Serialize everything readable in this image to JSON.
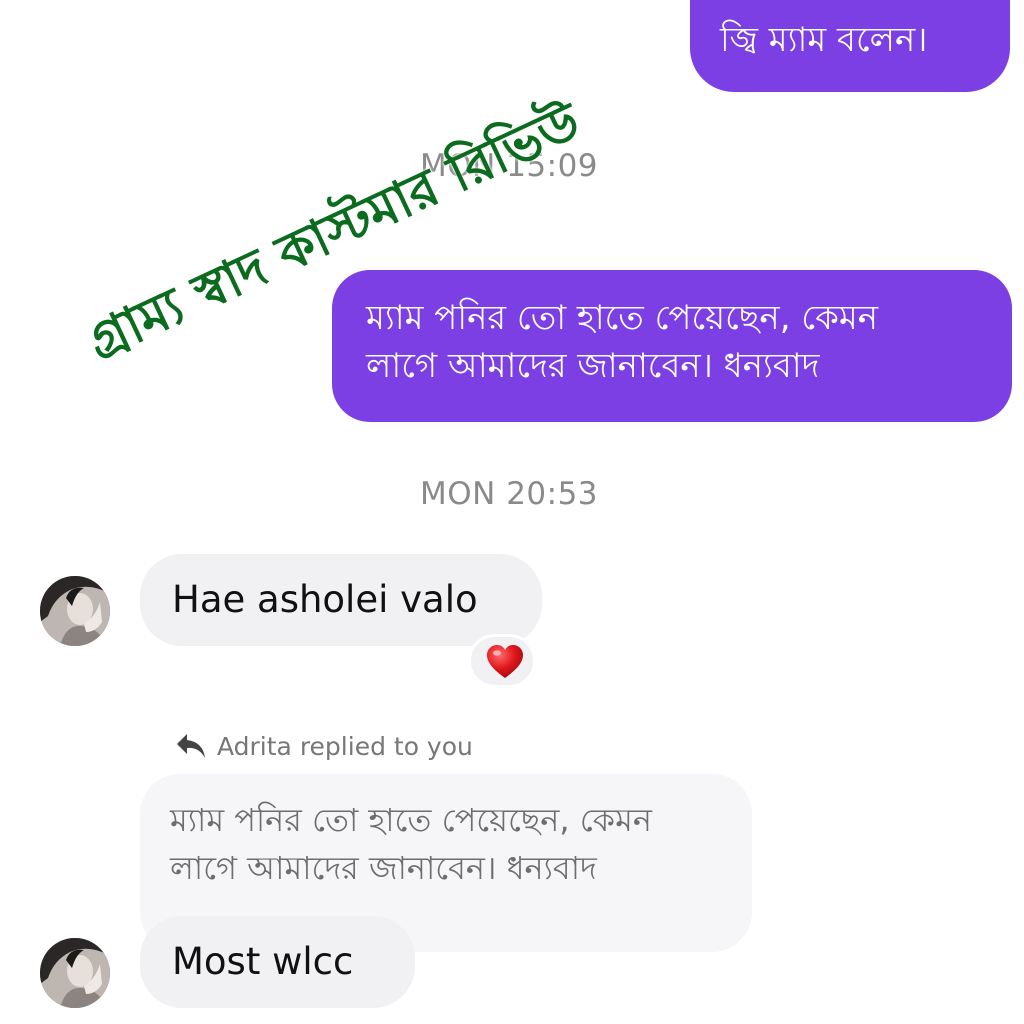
{
  "overlay": {
    "title": "গ্রাম্য স্বাদ কাস্টমার রিভিউ",
    "color": "#0b6b1e"
  },
  "messages": {
    "outgoing_1": {
      "text": "জ্বি ম্যাম বলেন।"
    },
    "timestamp_1": "MON 15:09",
    "outgoing_2": {
      "line1": "ম্যাম পনির তো হাতে পেয়েছেন, কেমন",
      "line2": "লাগে আমাদের জানাবেন। ধন্যবাদ"
    },
    "timestamp_2": "MON 20:53",
    "incoming_1": {
      "text": "Hae asholei valo",
      "reaction": "❤️"
    },
    "reply": {
      "header": "Adrita replied to you",
      "quoted_line1": "ম্যাম পনির তো হাতে পেয়েছেন, কেমন",
      "quoted_line2": "লাগে আমাদের জানাবেন। ধন্যবাদ"
    },
    "incoming_2": {
      "text": "Most wlcc"
    }
  },
  "colors": {
    "outgoing_bubble": "#7b3fe4",
    "incoming_bubble": "#f1f1f3",
    "timestamp": "#8a8a8a"
  }
}
